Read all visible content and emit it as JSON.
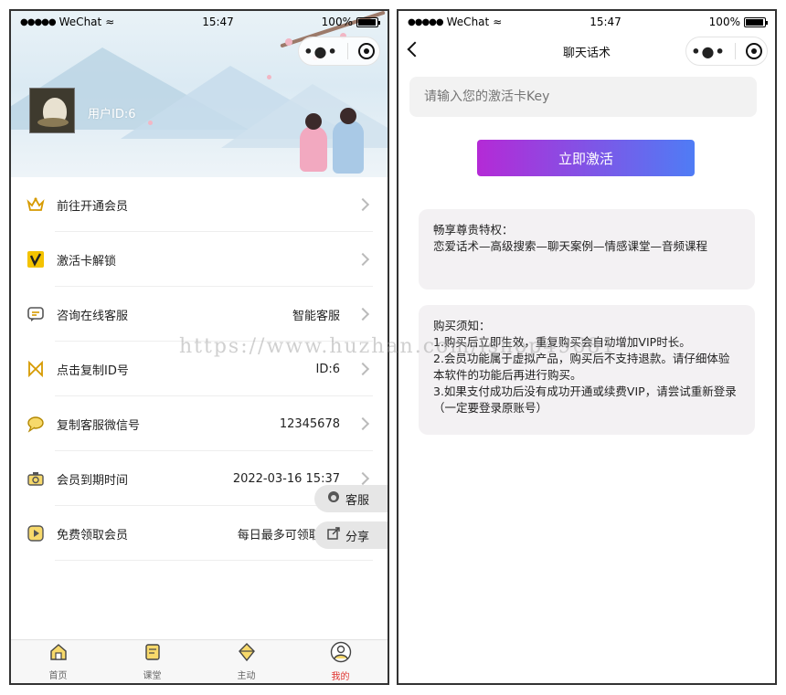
{
  "status_bar": {
    "signal": "●●●●●",
    "carrier": "WeChat",
    "time": "15:47",
    "battery": "100%"
  },
  "left": {
    "user_id": "用户ID:6",
    "menu": [
      {
        "label": "前往开通会员",
        "value": "",
        "icon": "crown-icon",
        "color": "#e0a800"
      },
      {
        "label": "激活卡解锁",
        "value": "",
        "icon": "vip-card-icon",
        "color": "#f4c300"
      },
      {
        "label": "咨询在线客服",
        "value": "智能客服",
        "icon": "chat-icon",
        "color": "#d69a00"
      },
      {
        "label": "点击复制ID号",
        "value": "ID:6",
        "icon": "bowtie-icon",
        "color": "#d69a00"
      },
      {
        "label": "复制客服微信号",
        "value": "12345678",
        "icon": "speech-icon",
        "color": "#d69a00"
      },
      {
        "label": "会员到期时间",
        "value": "2022-03-16 15:37",
        "icon": "camera-icon",
        "color": "#d69a00"
      },
      {
        "label": "免费领取会员",
        "value": "每日最多可领取5次",
        "icon": "play-icon",
        "color": "#d69a00"
      }
    ],
    "float_service": "客服",
    "float_share": "分享",
    "tabs": [
      {
        "label": "首页",
        "icon": "home-icon",
        "active": false
      },
      {
        "label": "课堂",
        "icon": "notes-icon",
        "active": false
      },
      {
        "label": "主动",
        "icon": "diamond-icon",
        "active": false
      },
      {
        "label": "我的",
        "icon": "profile-icon",
        "active": true
      }
    ]
  },
  "right": {
    "title": "聊天话术",
    "input_placeholder": "请输入您的激活卡Key",
    "activate_button": "立即激活",
    "privilege": {
      "heading": "畅享尊贵特权：",
      "body": "恋爱话术—高级搜索—聊天案例—情感课堂—音频课程"
    },
    "notice": {
      "heading": "购买须知：",
      "lines": [
        "1.购买后立即生效，重复购买会自动增加VIP时长。",
        "2.会员功能属于虚拟产品，购买后不支持退款。请仔细体验本软件的功能后再进行购买。",
        "3.如果支付成功后没有成功开通或续费VIP，请尝试重新登录（一定要登录原账号）"
      ]
    }
  },
  "watermark": "https://www.huzhan.com/ishop49681"
}
